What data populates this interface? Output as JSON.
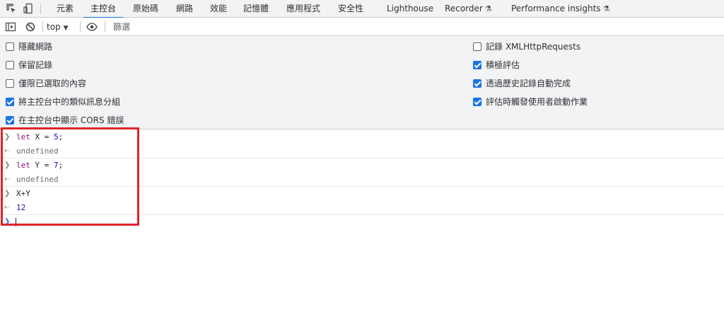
{
  "tabs": [
    {
      "label": "元素",
      "active": false
    },
    {
      "label": "主控台",
      "active": true
    },
    {
      "label": "原始碼",
      "active": false
    },
    {
      "label": "網路",
      "active": false
    },
    {
      "label": "效能",
      "active": false
    },
    {
      "label": "記憶體",
      "active": false
    },
    {
      "label": "應用程式",
      "active": false
    },
    {
      "label": "安全性",
      "active": false
    },
    {
      "label": "Lighthouse",
      "active": false
    },
    {
      "label": "Recorder",
      "active": false,
      "experimental": true
    },
    {
      "label": "Performance insights",
      "active": false,
      "experimental": true
    }
  ],
  "toolbar": {
    "context": "top",
    "filter_placeholder": "篩選"
  },
  "settings": {
    "left": [
      {
        "label": "隱藏網路",
        "checked": false
      },
      {
        "label": "保留記錄",
        "checked": false
      },
      {
        "label": "僅限已選取的內容",
        "checked": false
      },
      {
        "label": "將主控台中的類似訊息分組",
        "checked": true
      },
      {
        "label": "在主控台中顯示 CORS 錯誤",
        "checked": true
      }
    ],
    "right": [
      {
        "label": "記錄 XMLHttpRequests",
        "checked": false
      },
      {
        "label": "積極評估",
        "checked": true
      },
      {
        "label": "透過歷史記錄自動完成",
        "checked": true
      },
      {
        "label": "評估時觸發使用者啟動作業",
        "checked": true
      }
    ]
  },
  "console": {
    "entries": [
      {
        "kind": "input",
        "keyword": "let",
        "name": " X = ",
        "value": "5",
        "end": ";"
      },
      {
        "kind": "result",
        "text": "undefined"
      },
      {
        "kind": "input",
        "keyword": "let",
        "name": " Y = ",
        "value": "7",
        "end": ";"
      },
      {
        "kind": "result",
        "text": "undefined"
      },
      {
        "kind": "input_plain",
        "text": "X+Y"
      },
      {
        "kind": "result_number",
        "text": "12"
      }
    ]
  },
  "colors": {
    "accent": "#1a73e8",
    "highlight_box": "#e0242a",
    "keyword": "#881280",
    "number": "#1c00cf"
  },
  "icons": [
    "inspect-element-icon",
    "device-toolbar-icon",
    "sidebar-toggle-icon",
    "clear-console-icon",
    "eye-icon",
    "flask-icon",
    "prompt-chevron-icon",
    "result-arrow-icon"
  ]
}
